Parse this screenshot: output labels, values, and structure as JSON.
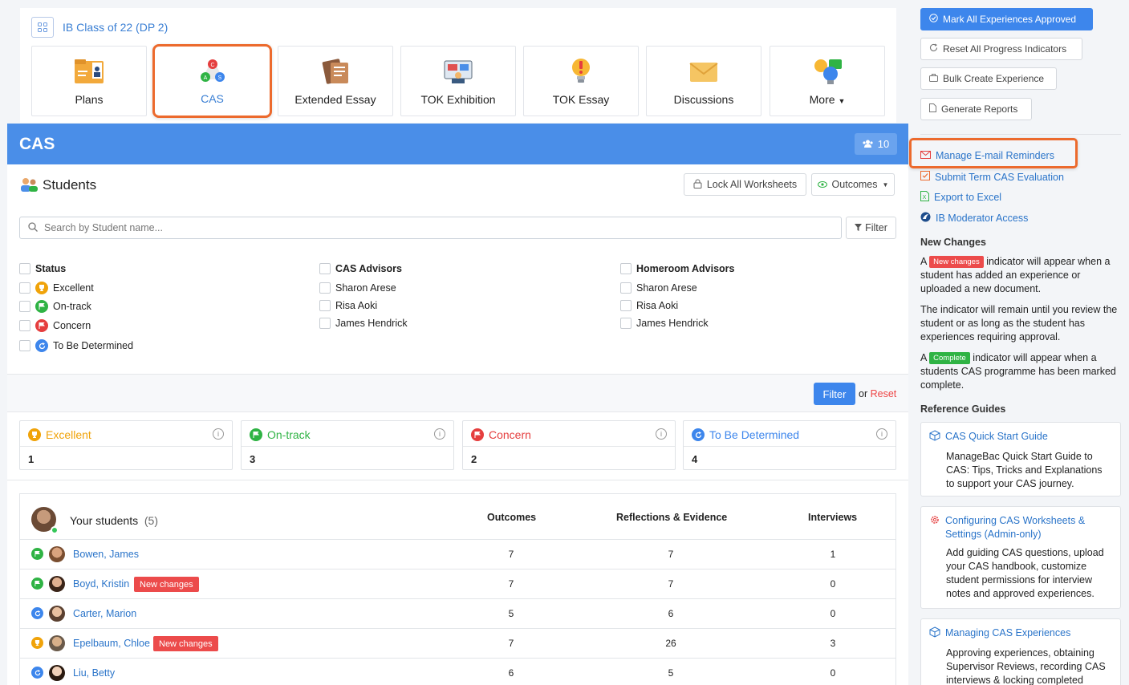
{
  "class_title": "IB Class of 22 (DP 2)",
  "tiles": [
    {
      "label": "Plans",
      "icon": "plans-icon",
      "active": false
    },
    {
      "label": "CAS",
      "icon": "cas-icon",
      "active": true
    },
    {
      "label": "Extended Essay",
      "icon": "extended-essay-icon",
      "active": false
    },
    {
      "label": "TOK Exhibition",
      "icon": "tok-exhibition-icon",
      "active": false
    },
    {
      "label": "TOK Essay",
      "icon": "tok-essay-icon",
      "active": false
    },
    {
      "label": "Discussions",
      "icon": "discussions-icon",
      "active": false
    },
    {
      "label": "More",
      "icon": "more-icon",
      "active": false
    }
  ],
  "cas": {
    "title": "CAS",
    "member_count": "10",
    "students_title": "Students",
    "lock_all": "Lock All Worksheets",
    "outcomes_btn": "Outcomes",
    "search_placeholder": "Search by Student name...",
    "filter_label": "Filter",
    "filters": {
      "status": {
        "heading": "Status",
        "items": [
          "Excellent",
          "On-track",
          "Concern",
          "To Be Determined"
        ]
      },
      "cas_advisors": {
        "heading": "CAS Advisors",
        "items": [
          "Sharon Arese",
          "Risa Aoki",
          "James Hendrick"
        ]
      },
      "homeroom_advisors": {
        "heading": "Homeroom Advisors",
        "items": [
          "Sharon Arese",
          "Risa Aoki",
          "James Hendrick"
        ]
      }
    },
    "filter_button": "Filter",
    "or_text": "or",
    "reset_text": "Reset",
    "stats": [
      {
        "label": "Excellent",
        "count": "1",
        "color": "#f0a30a"
      },
      {
        "label": "On-track",
        "count": "3",
        "color": "#2fb344"
      },
      {
        "label": "Concern",
        "count": "2",
        "color": "#e53e3e"
      },
      {
        "label": "To Be Determined",
        "count": "4",
        "color": "#3d86ec"
      }
    ],
    "table": {
      "your_students": "Your students",
      "your_students_count": "(5)",
      "headers": [
        "Outcomes",
        "Reflections & Evidence",
        "Interviews"
      ],
      "rows": [
        {
          "name": "Bowen, James",
          "status": "on-track",
          "new_changes": "",
          "outcomes": "7",
          "reflections": "7",
          "interviews": "1"
        },
        {
          "name": "Boyd, Kristin",
          "status": "on-track",
          "new_changes": "New changes",
          "outcomes": "7",
          "reflections": "7",
          "interviews": "0"
        },
        {
          "name": "Carter, Marion",
          "status": "tbd",
          "new_changes": "",
          "outcomes": "5",
          "reflections": "6",
          "interviews": "0"
        },
        {
          "name": "Epelbaum, Chloe",
          "status": "excellent",
          "new_changes": "New changes",
          "outcomes": "7",
          "reflections": "26",
          "interviews": "3"
        },
        {
          "name": "Liu, Betty",
          "status": "tbd",
          "new_changes": "",
          "outcomes": "6",
          "reflections": "5",
          "interviews": "0"
        }
      ]
    }
  },
  "sidebar": {
    "mark_all": "Mark All Experiences Approved",
    "reset_progress": "Reset All Progress Indicators",
    "bulk_create": "Bulk Create Experience",
    "generate_reports": "Generate Reports",
    "links": [
      "Manage E-mail Reminders",
      "Submit Term CAS Evaluation",
      "Export to Excel",
      "IB Moderator Access"
    ],
    "new_changes_heading": "New Changes",
    "nc_p1_a": "A",
    "nc_tag": "New changes",
    "nc_p1_b": "indicator will appear when a student has added an experience or uploaded a new document.",
    "nc_p2": "The indicator will remain until you review the student or as long as the student has experiences requiring approval.",
    "nc_p3_a": "A",
    "complete_tag": "Complete",
    "nc_p3_b": "indicator will appear when a students CAS programme has been marked complete.",
    "reference_heading": "Reference Guides",
    "guides": [
      {
        "title": "CAS Quick Start Guide",
        "desc": "ManageBac Quick Start Guide to CAS: Tips, Tricks and Explanations to support your CAS journey."
      },
      {
        "title": "Configuring CAS Worksheets & Settings (Admin-only)",
        "desc": "Add guiding CAS questions, upload your CAS handbook, customize student permissions for interview notes and approved experiences."
      },
      {
        "title": "Managing CAS Experiences",
        "desc": "Approving experiences, obtaining Supervisor Reviews, recording CAS interviews & locking completed"
      }
    ]
  }
}
